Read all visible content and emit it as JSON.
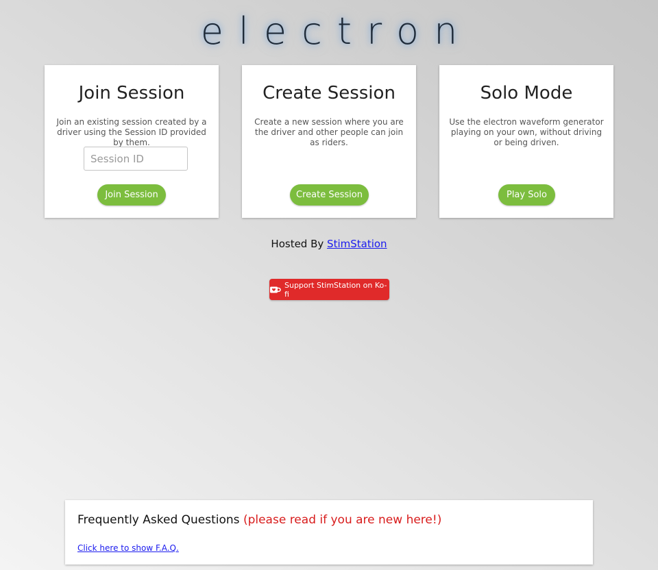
{
  "logo": {
    "text": "electron"
  },
  "cards": {
    "join": {
      "title": "Join Session",
      "description": "Join an existing session created by a driver using the Session ID provided by them.",
      "input_placeholder": "Session ID",
      "input_value": "",
      "button": "Join Session"
    },
    "create": {
      "title": "Create Session",
      "description": "Create a new session where you are the driver and other people can join as riders.",
      "button": "Create Session"
    },
    "solo": {
      "title": "Solo Mode",
      "description": "Use the electron waveform generator playing on your own, without driving or being driven.",
      "button": "Play Solo"
    }
  },
  "hosted": {
    "prefix": "Hosted By",
    "link": "StimStation"
  },
  "kofi": {
    "icon": "coffee-cup-icon",
    "label": "Support StimStation on Ko-fi"
  },
  "faq": {
    "title": "Frequently Asked Questions",
    "note": "(please read if you are new here!)",
    "link": "Click here to show F.A.Q."
  },
  "colors": {
    "green_button": "#7cbd3e",
    "kofi_red": "#e02a2a",
    "faq_note_red": "#d81c1c",
    "link_blue": "#1a1aee",
    "logo_glow": "#78aae1"
  }
}
